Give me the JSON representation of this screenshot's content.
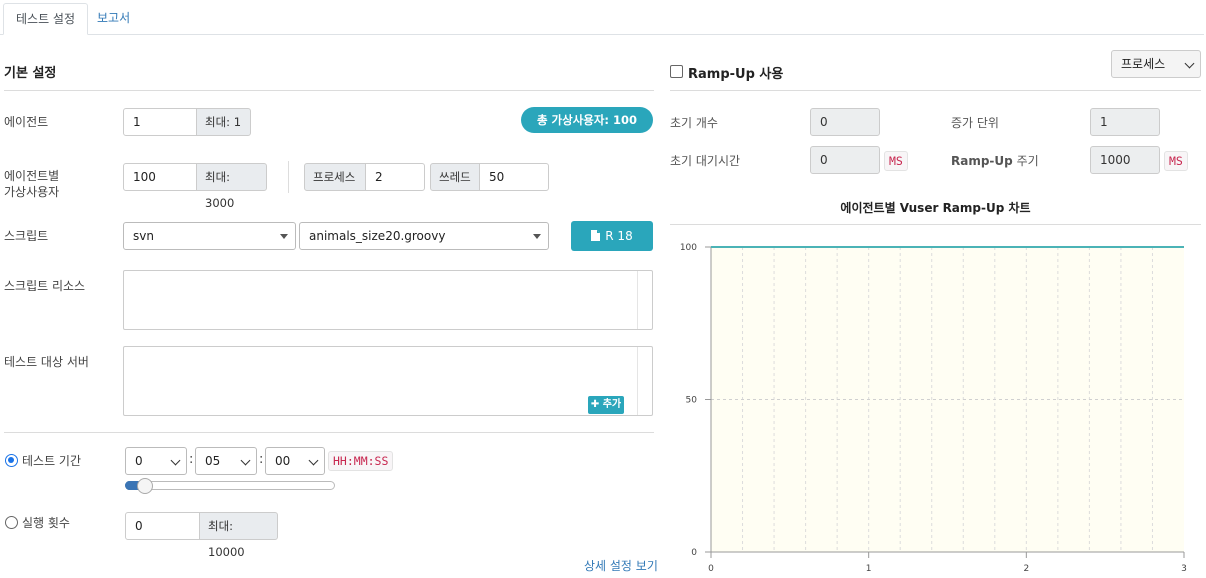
{
  "tabs": [
    {
      "label": "테스트 설정",
      "active": true
    },
    {
      "label": "보고서",
      "active": false
    }
  ],
  "basic": {
    "title": "기본 설정",
    "agent": {
      "label": "에이전트",
      "value": "1",
      "max": "최대: 1"
    },
    "total_vusers_badge": "총 가상사용자: 100",
    "vuser_per_agent": {
      "label_line1": "에이전트별",
      "label_line2": "가상사용자",
      "value": "100",
      "max": "최대: 3000",
      "process_label": "프로세스",
      "process_value": "2",
      "thread_label": "쓰레드",
      "thread_value": "50"
    },
    "script": {
      "label": "스크립트",
      "repo": "svn",
      "file": "animals_size20.groovy",
      "revision_button": "R 18"
    },
    "script_resource": {
      "label": "스크립트 리소스"
    },
    "target_server": {
      "label": "테스트 대상 서버",
      "add_button": "추가"
    },
    "duration": {
      "label": "테스트 기간",
      "selected": true,
      "hours": "0",
      "minutes": "05",
      "seconds": "00",
      "format": "HH:MM:SS",
      "slider_fraction": 0.05
    },
    "run_count": {
      "label": "실행 횟수",
      "selected": false,
      "value": "0",
      "max": "최대: 10000"
    },
    "advanced_link": "상세 설정 보기"
  },
  "rampup": {
    "checkbox_label": "Ramp-Up 사용",
    "checked": false,
    "type_select": "프로세스",
    "initial_count": {
      "label": "초기 개수",
      "value": "0"
    },
    "increment": {
      "label": "증가 단위",
      "value": "1"
    },
    "initial_sleep": {
      "label": "초기 대기시간",
      "value": "0",
      "unit": "MS"
    },
    "interval": {
      "label_bold": "Ramp-Up",
      "label_rest": "주기",
      "value": "1000",
      "unit": "MS"
    }
  },
  "chart_data": {
    "type": "line",
    "title": "에이전트별 Vuser Ramp-Up 차트",
    "x": [
      0,
      3
    ],
    "series": [
      {
        "values": [
          100,
          100
        ]
      }
    ],
    "xlim": [
      0,
      3
    ],
    "ylim": [
      0,
      100
    ],
    "x_ticks": [
      "0",
      "1",
      "2",
      "3"
    ],
    "y_ticks": [
      "0",
      "50",
      "100"
    ],
    "grid": true,
    "line_color": "#4bb3b6",
    "plot_bg": "#fffef3"
  }
}
